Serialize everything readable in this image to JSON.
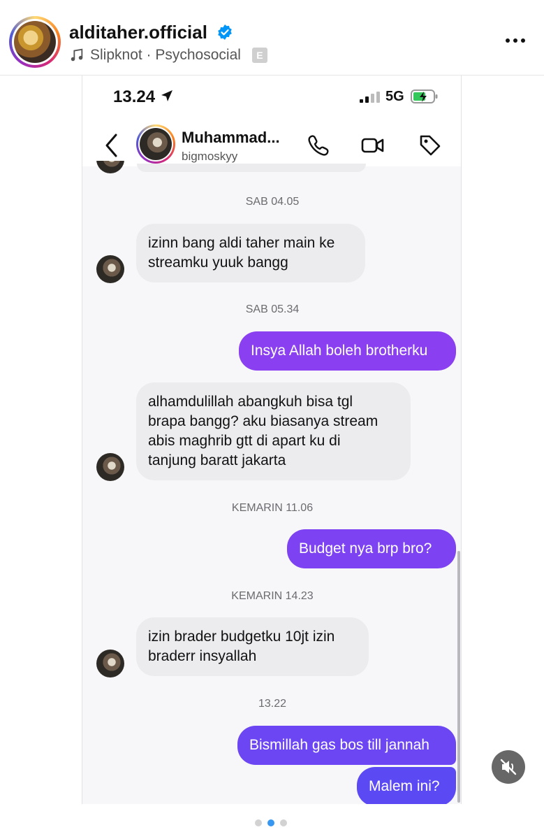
{
  "post": {
    "account_name": "alditaher.official",
    "verified": true,
    "music": "Slipknot · Psychosocial",
    "explicit_badge": "E",
    "verified_icon": "verified-badge-icon",
    "music_icon": "music-note-icon",
    "more_icon": "more-horizontal-icon"
  },
  "status_bar": {
    "time": "13.24",
    "network": "5G"
  },
  "chat_header": {
    "contact_name": "Muhammad...",
    "contact_username": "bigmoskyy",
    "icons": [
      "back-chevron-icon",
      "phone-icon",
      "video-camera-icon",
      "tag-icon"
    ]
  },
  "messages": {
    "ts1": "SAB 04.05",
    "m1": [
      "izinn bang aldi taher main ke",
      "streamku yuuk bangg"
    ],
    "ts2": "SAB 05.34",
    "m2": "Insya Allah boleh brotherku",
    "m3": [
      "alhamdulillah abangkuh bisa tgl",
      "brapa bangg? aku biasanya stream",
      "abis maghrib gtt di apart ku di",
      "tanjung baratt jakarta"
    ],
    "ts3": "KEMARIN 11.06",
    "m4": "Budget nya brp bro?",
    "ts4": "KEMARIN 14.23",
    "m5": [
      "izin brader budgetku 10jt izin",
      "braderr insyallah"
    ],
    "ts5": "13.22",
    "m6": "Bismillah gas bos till jannah",
    "m7": "Malem ini?"
  },
  "colors": {
    "outgoing_purple": "#8a3ff0",
    "outgoing_violet": "#6b46f2",
    "incoming_gray": "#ececef",
    "dot_active": "#3897f0"
  },
  "carousel": {
    "slides": 3,
    "active_index": 1
  },
  "mute_icon": "muted-speaker-icon"
}
